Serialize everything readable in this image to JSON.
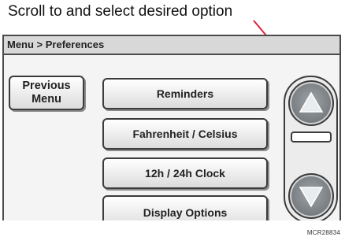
{
  "caption": "Scroll to and select desired option",
  "header": {
    "breadcrumb": "Menu > Preferences"
  },
  "buttons": {
    "previous_menu_line1": "Previous",
    "previous_menu_line2": "Menu"
  },
  "options": [
    "Reminders",
    "Fahrenheit / Celsius",
    "12h / 24h Clock",
    "Display Options"
  ],
  "scrollbar": {
    "up_icon": "up-arrow-icon",
    "down_icon": "down-arrow-icon"
  },
  "footer_code": "MCR28834",
  "colors": {
    "pointer_line": "#e0213a",
    "arrow_button": "#7b8084"
  }
}
